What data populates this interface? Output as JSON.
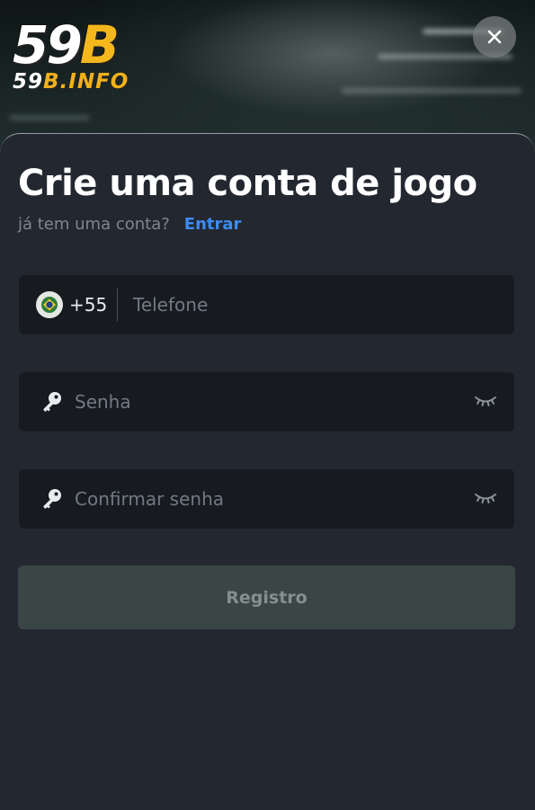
{
  "logo": {
    "main_num": "59",
    "main_letter": "B",
    "sub_num": "59",
    "sub_rest": "B.INFO"
  },
  "header": {
    "close_icon": "close-icon"
  },
  "form": {
    "title": "Crie uma conta de jogo",
    "have_account": "já tem uma conta?",
    "login_link": "Entrar",
    "phone": {
      "country_code": "+55",
      "flag_icon": "brazil-flag-icon",
      "placeholder": "Telefone"
    },
    "password": {
      "placeholder": "Senha",
      "icon": "key-icon",
      "toggle_icon": "eye-closed-icon"
    },
    "confirm_password": {
      "placeholder": "Confirmar senha",
      "icon": "key-icon",
      "toggle_icon": "eye-closed-icon"
    },
    "register_label": "Registro"
  },
  "colors": {
    "panel_bg": "#232830",
    "field_bg": "#171b20",
    "link": "#3d8cf2",
    "button_bg": "#3a4646",
    "logo_gold": "#f4b81d"
  }
}
